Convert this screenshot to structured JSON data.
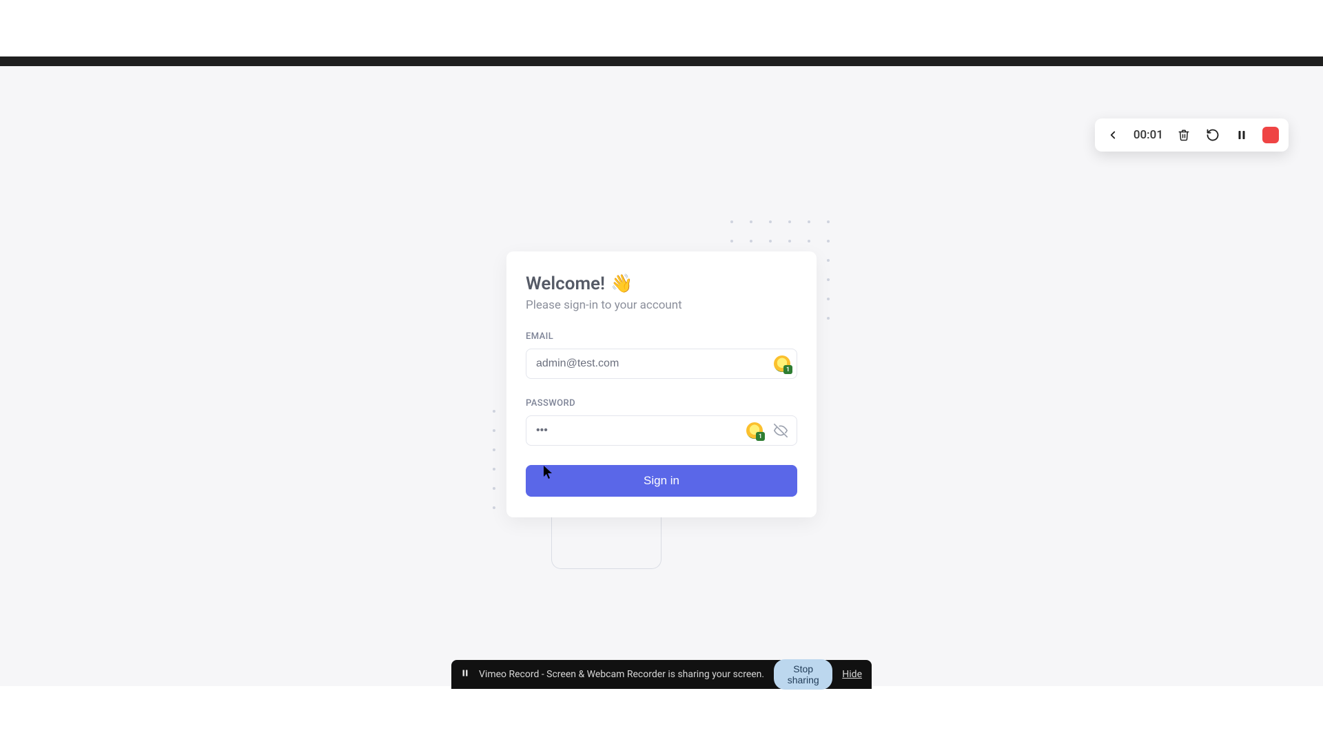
{
  "recorder": {
    "time": "00:01"
  },
  "login": {
    "welcome": "Welcome!",
    "wave_emoji": "👋",
    "subtitle": "Please sign-in to your account",
    "email_label": "EMAIL",
    "email_value": "admin@test.com",
    "password_label": "PASSWORD",
    "password_value": "•••",
    "pw_manager_count": "1",
    "signin_label": "Sign in"
  },
  "share": {
    "app_text": "Vimeo Record - Screen & Webcam Recorder is sharing your screen.",
    "stop_label": "Stop sharing",
    "hide_label": "Hide"
  }
}
